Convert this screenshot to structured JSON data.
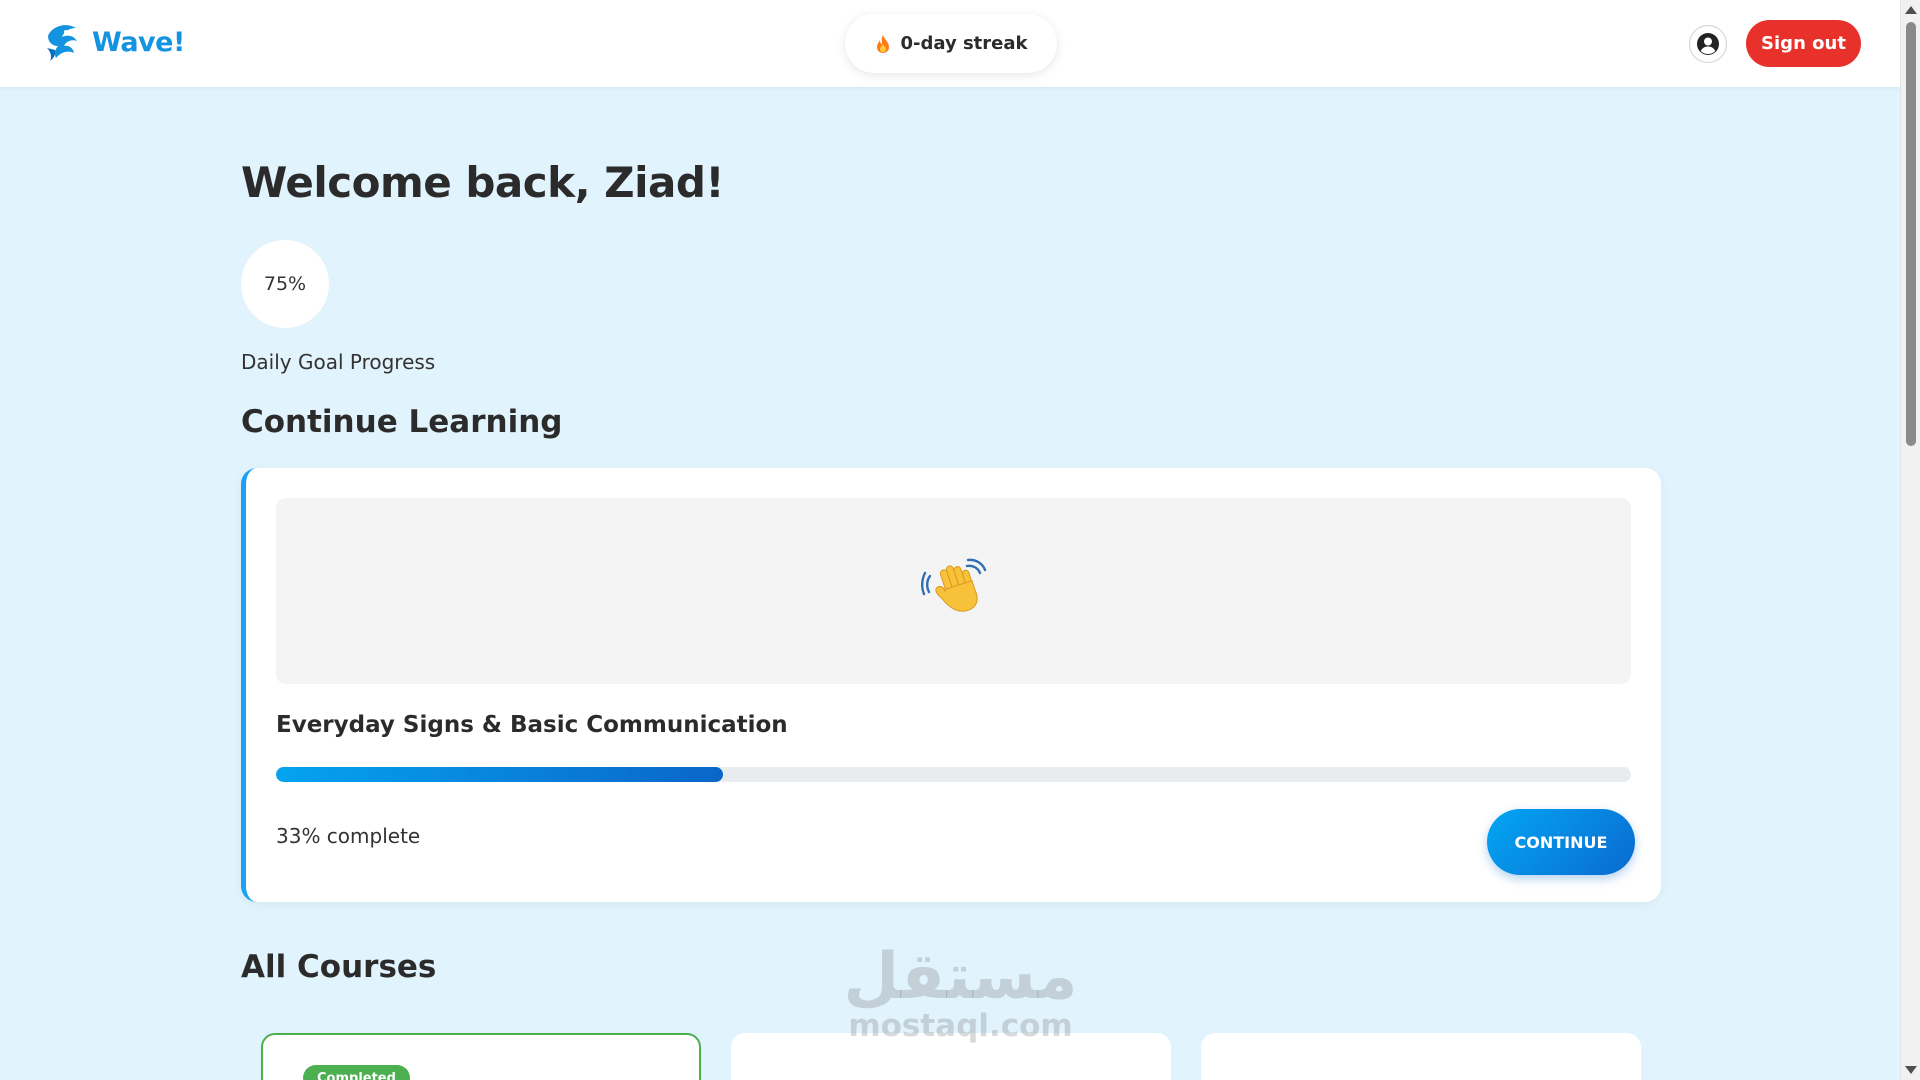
{
  "header": {
    "brand_name": "Wave!",
    "streak_label": "0-day streak",
    "sign_out_label": "Sign out"
  },
  "icons": {
    "brand": "wave-logo-icon",
    "streak": "flame-icon",
    "profile": "user-circle-icon",
    "lesson": "waving-hand-icon"
  },
  "colors": {
    "brand": "#1493e0",
    "background": "#e1f3fd",
    "sign_out": "#e8312b",
    "accent": "#1da1f2",
    "completed": "#4caf50"
  },
  "main": {
    "welcome_heading": "Welcome back, Ziad!",
    "daily_goal": {
      "value_label": "75%",
      "value": 75,
      "label": "Daily Goal Progress"
    },
    "continue_section_title": "Continue Learning",
    "current_course": {
      "title": "Everyday Signs & Basic Communication",
      "progress": 33,
      "progress_label": "33% complete",
      "continue_label": "CONTINUE"
    },
    "all_courses_title": "All Courses",
    "course_cards": [
      {
        "badge": "Completed"
      },
      {},
      {}
    ]
  },
  "watermark": {
    "arabic": "مستقل",
    "latin": "mostaql.com"
  }
}
